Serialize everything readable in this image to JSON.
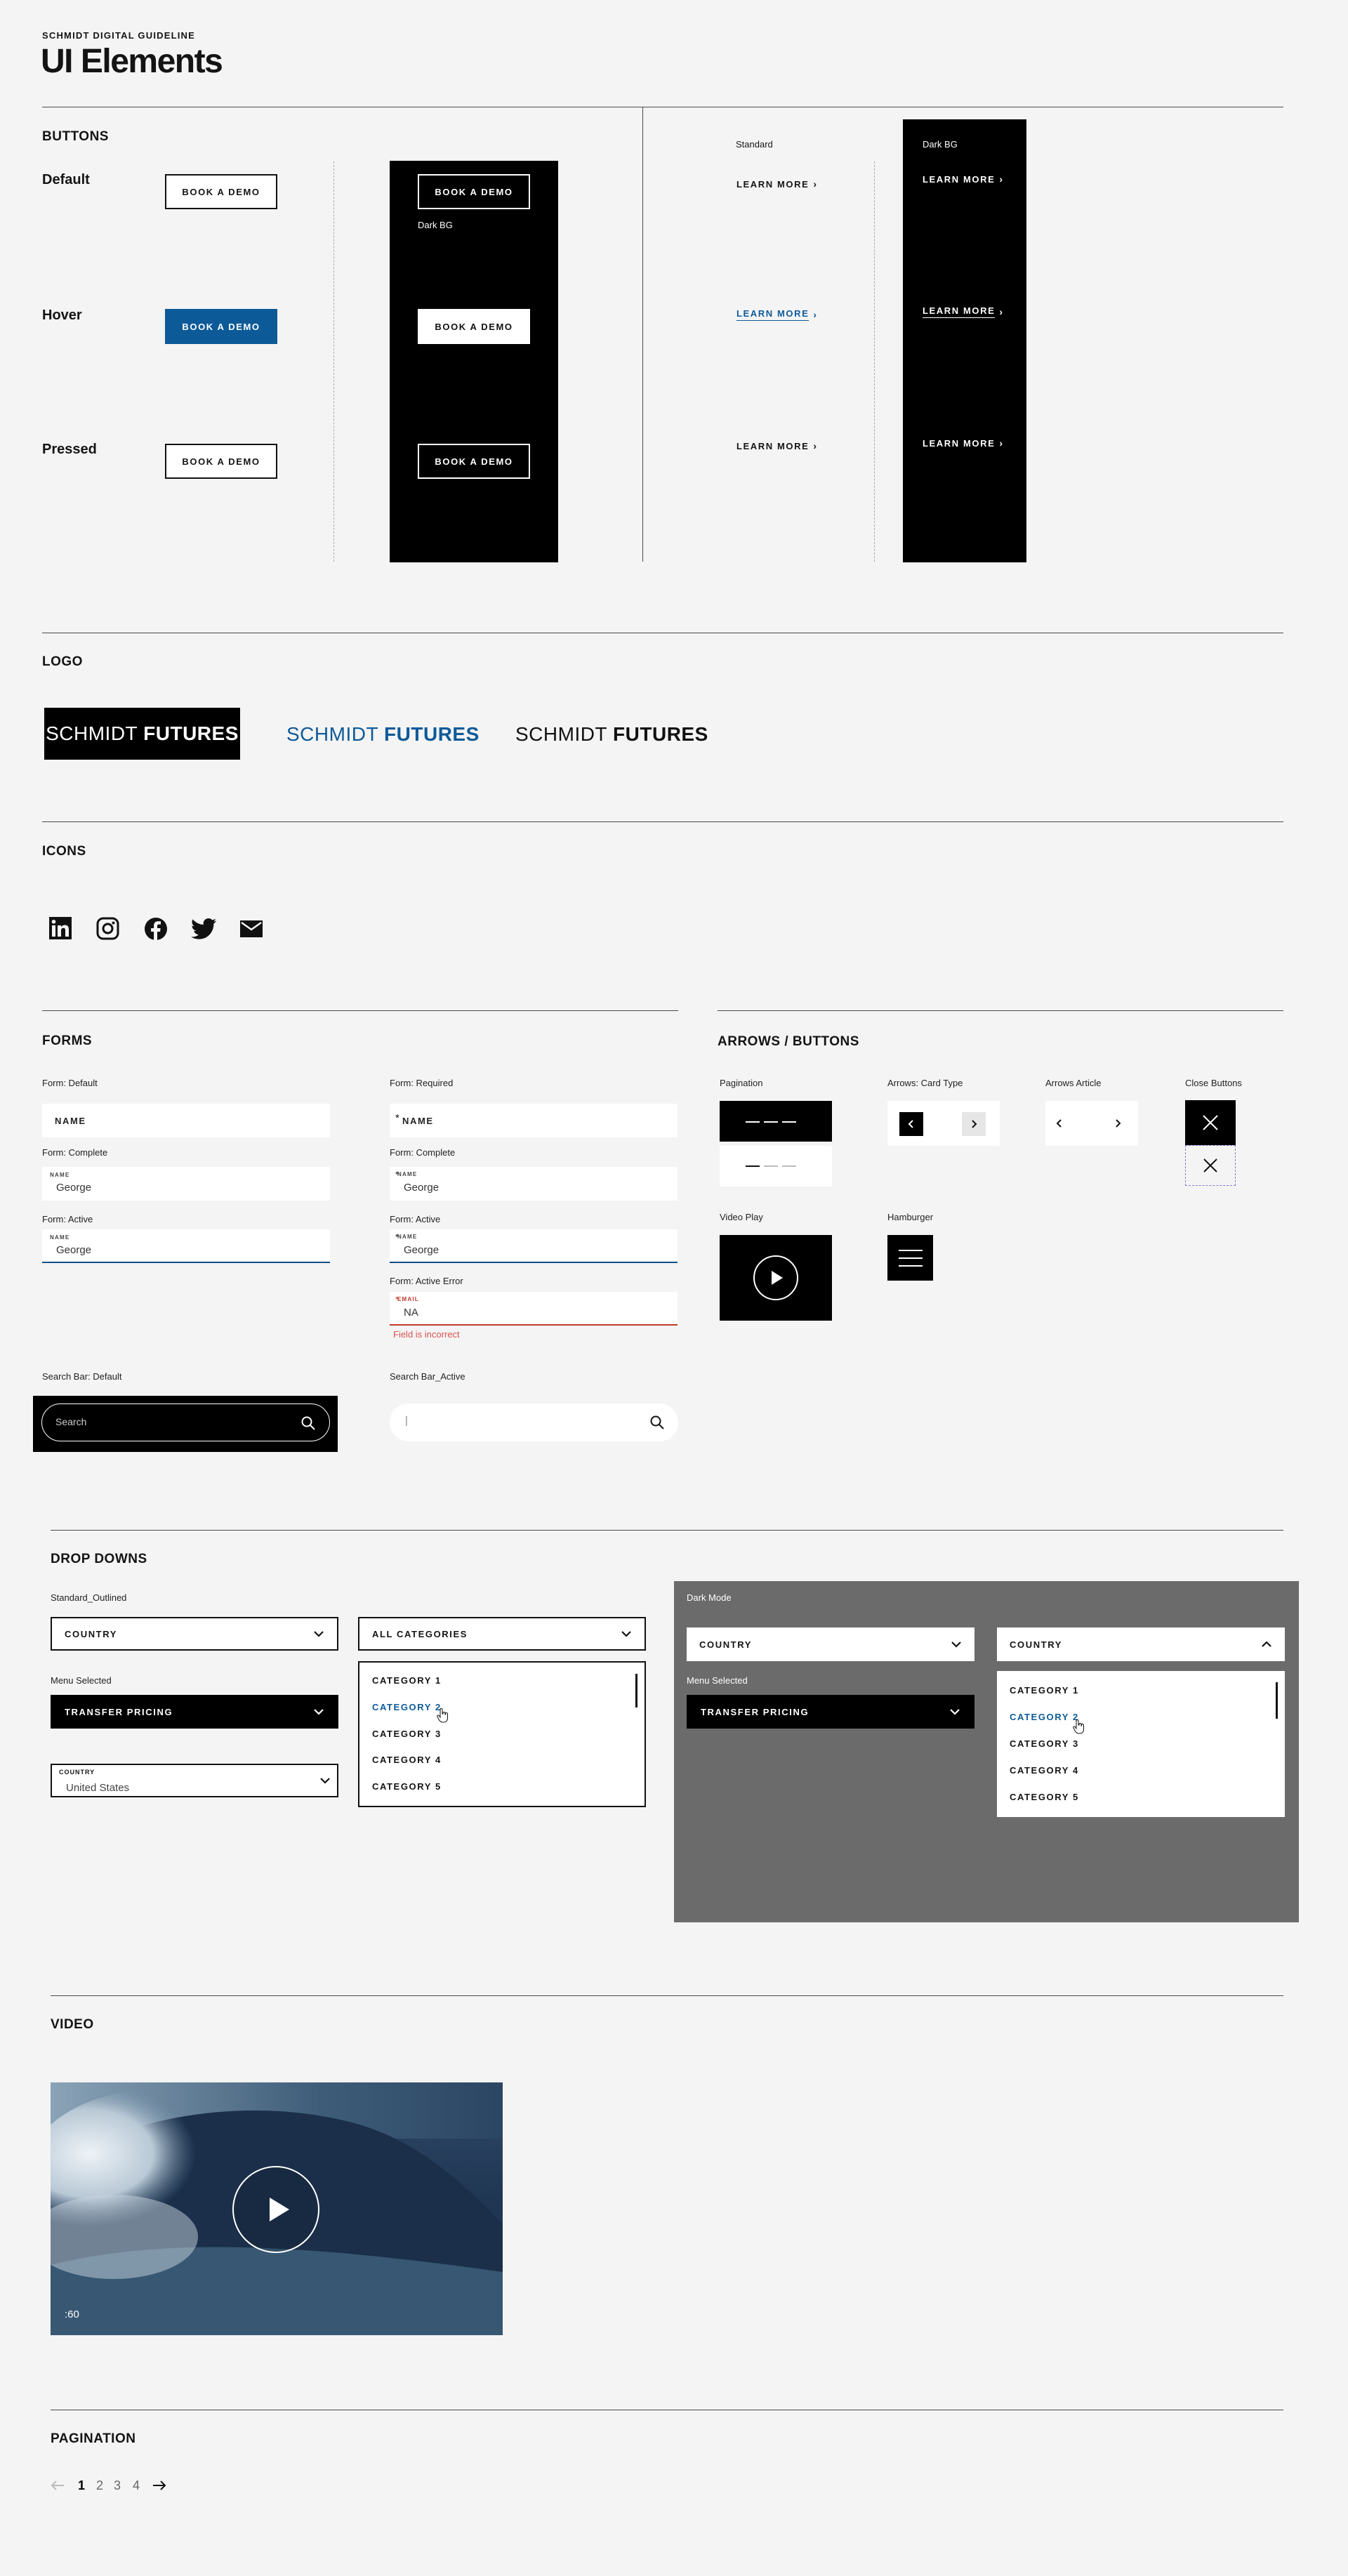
{
  "header": {
    "eyebrow": "SCHMIDT DIGITAL GUIDELINE",
    "title": "UI Elements"
  },
  "buttons": {
    "section_title": "BUTTONS",
    "rows": [
      "Default",
      "Hover",
      "Pressed"
    ],
    "book_label": "BOOK A DEMO",
    "dark_bg_label": "Dark BG",
    "standard_label": "Standard",
    "learn_label": "LEARN MORE"
  },
  "logo": {
    "section_title": "LOGO",
    "word1": "SCHMIDT",
    "word2": "FUTURES",
    "colors": {
      "dark_bg": "#000000",
      "blue": "#0d5a99"
    }
  },
  "icons": {
    "section_title": "ICONS",
    "items": [
      "linkedin-icon",
      "instagram-icon",
      "facebook-icon",
      "twitter-icon",
      "mail-icon"
    ]
  },
  "forms": {
    "section_title": "FORMS",
    "default_label": "Form: Default",
    "required_label": "Form: Required",
    "complete_label": "Form: Complete",
    "active_label": "Form: Active",
    "active_error_label": "Form: Active Error",
    "name_placeholder": "NAME",
    "name_small": "NAME",
    "value": "George",
    "email_small": "EMAIL",
    "email_value": "NA",
    "required_mark": "*",
    "error_message": "Field is incorrect",
    "search_default_label": "Search Bar: Default",
    "search_active_label": "Search Bar_Active",
    "search_placeholder": "Search",
    "search_active_value": "|"
  },
  "arrows": {
    "section_title": "ARROWS / BUTTONS",
    "pagination_label": "Pagination",
    "card_label": "Arrows: Card Type",
    "article_label": "Arrows Article",
    "close_label": "Close Buttons",
    "video_play_label": "Video Play",
    "hamburger_label": "Hamburger"
  },
  "dropdowns": {
    "section_title": "DROP DOWNS",
    "standard_label": "Standard_Outlined",
    "country": "COUNTRY",
    "all_categories": "ALL CATEGORIES",
    "menu_selected_label": "Menu Selected",
    "transfer_pricing": "TRANSFER PRICING",
    "country_small": "COUNTRY",
    "country_value": "United States",
    "categories": [
      "CATEGORY 1",
      "CATEGORY 2",
      "CATEGORY 3",
      "CATEGORY 4",
      "CATEGORY 5"
    ],
    "selected_index": 1,
    "dark_mode_label": "Dark Mode",
    "colors": {
      "dark_panel": "#6b6b6b",
      "selected": "#0d5a99"
    }
  },
  "video": {
    "section_title": "VIDEO",
    "duration": ":60"
  },
  "pagination": {
    "section_title": "PAGINATION",
    "pages": [
      "1",
      "2",
      "3",
      "4"
    ],
    "current": "1"
  }
}
